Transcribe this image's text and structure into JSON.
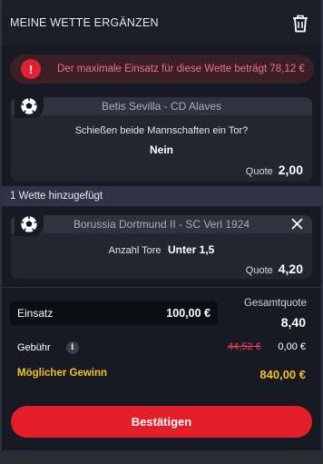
{
  "header": {
    "title": "MEINE WETTE ERGÄNZEN",
    "trash_icon": "trash-icon"
  },
  "alert": {
    "icon": "!",
    "text": "Der maximale Einsatz für diese Wette beträgt 78,12 €"
  },
  "bets": [
    {
      "match": "Betis Sevilla - CD Alaves",
      "question": "Schießen beide Mannschaften ein Tor?",
      "selection": "Nein",
      "odds_label": "Quote",
      "odds": "2,00"
    },
    {
      "match": "Borussia Dortmund II - SC Verl 1924",
      "question": "Anzahl Tore",
      "selection": "Unter 1,5",
      "odds_label": "Quote",
      "odds": "4,20"
    }
  ],
  "added_bar": {
    "text": "1 Wette hinzugefügt"
  },
  "summary": {
    "stake_label": "Einsatz",
    "stake_value": "100,00 €",
    "total_odds_label": "Gesamtquote",
    "total_odds_value": "8,40",
    "fee_label": "Gebühr",
    "fee_info": "i",
    "fee_old": "44,52 €",
    "fee_new": "0,00 €",
    "win_label": "Möglicher Gewinn",
    "win_value": "840,00 €"
  },
  "confirm_label": "Bestätigen",
  "colors": {
    "accent": "#e41e28",
    "gold": "#f3c31b",
    "alert_bg": "#3b1f26",
    "alert_text": "#f07080"
  }
}
